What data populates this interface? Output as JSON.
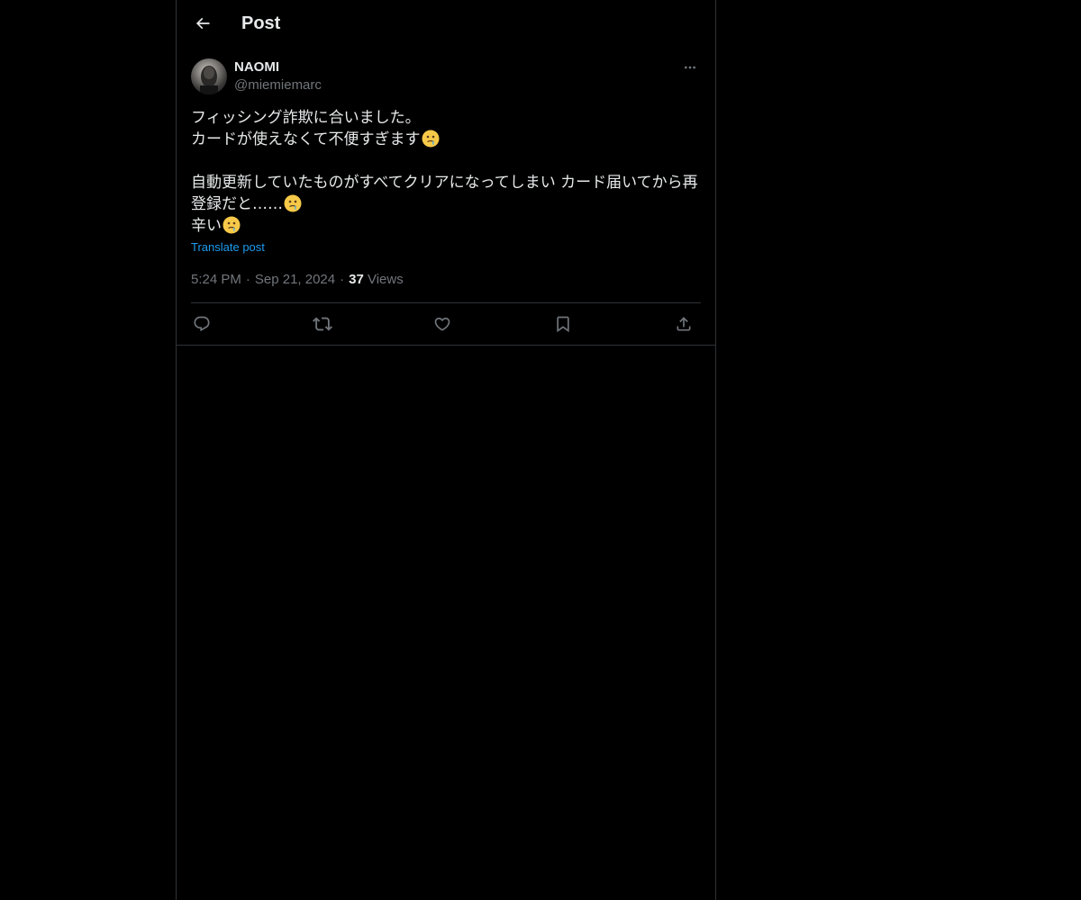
{
  "header": {
    "title": "Post",
    "back_icon": "arrow-left-icon"
  },
  "post": {
    "author": {
      "display_name": "NAOMI",
      "handle": "@miemiemarc"
    },
    "text_lines": [
      "フィッシング詐欺に合いました。",
      "カードが使えなくて不便すぎます",
      "",
      "自動更新していたものがすべてクリアになってしまい カード届いてから再",
      "登録だと……",
      "辛い"
    ],
    "emoji": "face-holding-back-tears",
    "translate_label": "Translate post",
    "time": "5:24 PM",
    "date": "Sep 21, 2024",
    "separator": "·",
    "views_count": "37",
    "views_label": "Views"
  },
  "actions": {
    "reply": "reply-icon",
    "repost": "repost-icon",
    "like": "heart-icon",
    "bookmark": "bookmark-icon",
    "share": "share-icon"
  },
  "colors": {
    "background": "#000000",
    "text": "#e7e9ea",
    "secondary": "#71767b",
    "link": "#1d9bf0",
    "border": "#2f3336"
  }
}
